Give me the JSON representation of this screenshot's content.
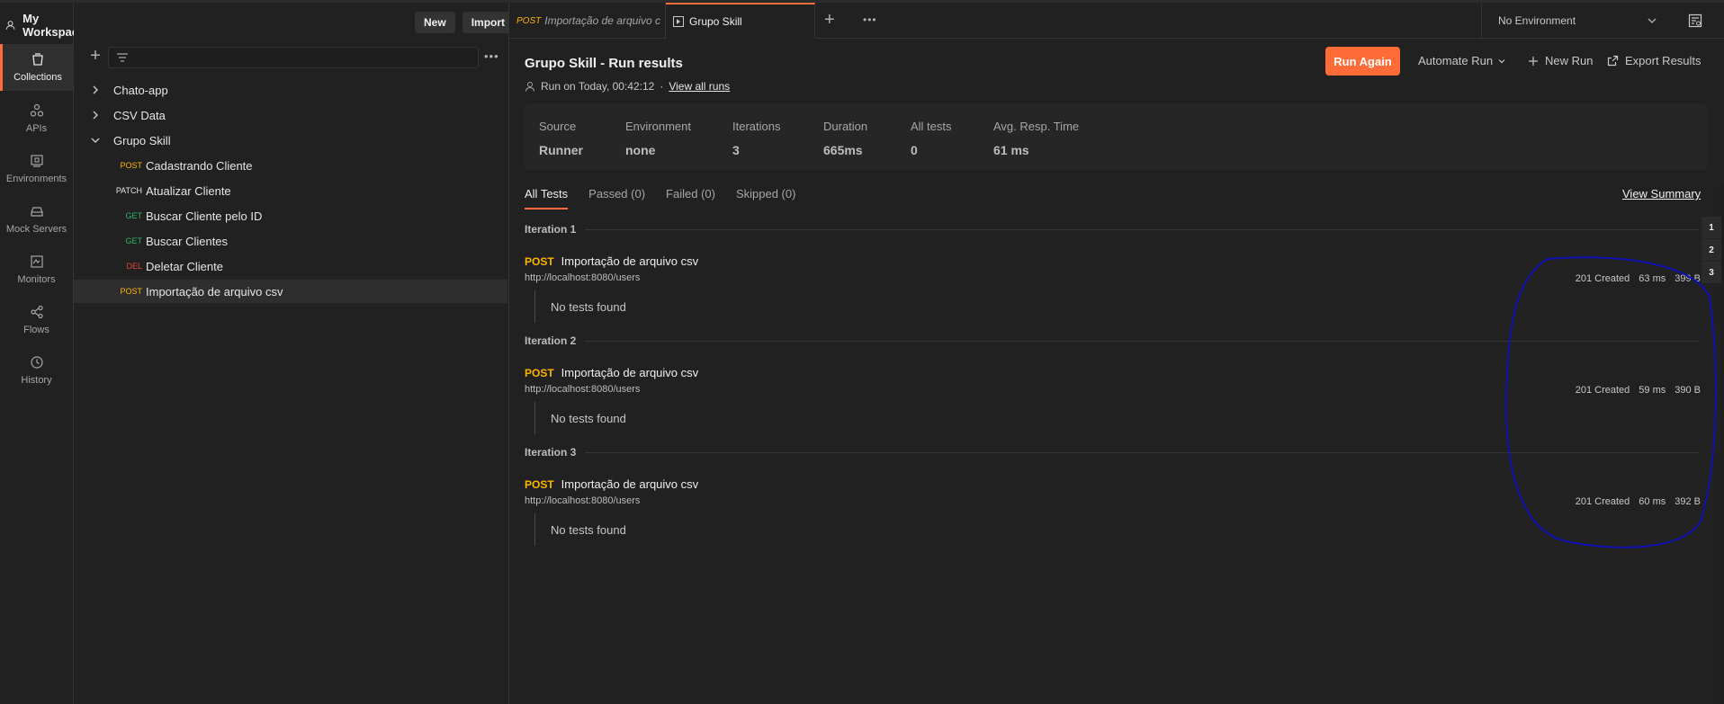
{
  "workspace": {
    "name": "My Workspace",
    "new_label": "New",
    "import_label": "Import"
  },
  "rail": [
    {
      "label": "Collections",
      "icon": "collections-icon",
      "active": true
    },
    {
      "label": "APIs",
      "icon": "apis-icon"
    },
    {
      "label": "Environments",
      "icon": "environments-icon"
    },
    {
      "label": "Mock Servers",
      "icon": "mock-servers-icon"
    },
    {
      "label": "Monitors",
      "icon": "monitors-icon"
    },
    {
      "label": "Flows",
      "icon": "flows-icon"
    },
    {
      "label": "History",
      "icon": "history-icon"
    }
  ],
  "tree": {
    "collections": [
      "Chato-app",
      "CSV Data",
      "Grupo Skill"
    ],
    "requests": [
      {
        "method": "POST",
        "name": "Cadastrando Cliente"
      },
      {
        "method": "PATCH",
        "name": "Atualizar Cliente"
      },
      {
        "method": "GET",
        "name": "Buscar Cliente pelo ID"
      },
      {
        "method": "GET",
        "name": "Buscar Clientes"
      },
      {
        "method": "DEL",
        "name": "Deletar Cliente"
      },
      {
        "method": "POST",
        "name": "Importação de arquivo csv"
      }
    ]
  },
  "tabs": {
    "tab1_method": "POST",
    "tab1_title": "Importação de arquivo c",
    "tab2_title": "Grupo Skill",
    "environment": "No Environment"
  },
  "run": {
    "title": "Grupo Skill - Run results",
    "run_on": "Run on Today, 00:42:12",
    "separator": "·",
    "view_all": "View all runs",
    "run_again": "Run Again",
    "automate": "Automate Run",
    "new_run": "New Run",
    "export": "Export Results"
  },
  "summary": [
    {
      "label": "Source",
      "value": "Runner"
    },
    {
      "label": "Environment",
      "value": "none"
    },
    {
      "label": "Iterations",
      "value": "3"
    },
    {
      "label": "Duration",
      "value": "665ms"
    },
    {
      "label": "All tests",
      "value": "0"
    },
    {
      "label": "Avg. Resp. Time",
      "value": "61 ms"
    }
  ],
  "filters": [
    "All Tests",
    "Passed (0)",
    "Failed (0)",
    "Skipped (0)"
  ],
  "view_summary": "View Summary",
  "iterations": [
    {
      "title": "Iteration 1",
      "method": "POST",
      "name": "Importação de arquivo csv",
      "url": "http://localhost:8080/users",
      "status": "201 Created",
      "time": "63 ms",
      "size": "399 B",
      "tests": "No tests found"
    },
    {
      "title": "Iteration 2",
      "method": "POST",
      "name": "Importação de arquivo csv",
      "url": "http://localhost:8080/users",
      "status": "201 Created",
      "time": "59 ms",
      "size": "390 B",
      "tests": "No tests found"
    },
    {
      "title": "Iteration 3",
      "method": "POST",
      "name": "Importação de arquivo csv",
      "url": "http://localhost:8080/users",
      "status": "201 Created",
      "time": "60 ms",
      "size": "392 B",
      "tests": "No tests found"
    }
  ],
  "iteration_nav": [
    "1",
    "2",
    "3"
  ],
  "colors": {
    "accent": "#ff6c37",
    "post": "#ffb400",
    "get": "#2fb36b",
    "delete": "#e0423a",
    "annotation": "#1010b0"
  }
}
